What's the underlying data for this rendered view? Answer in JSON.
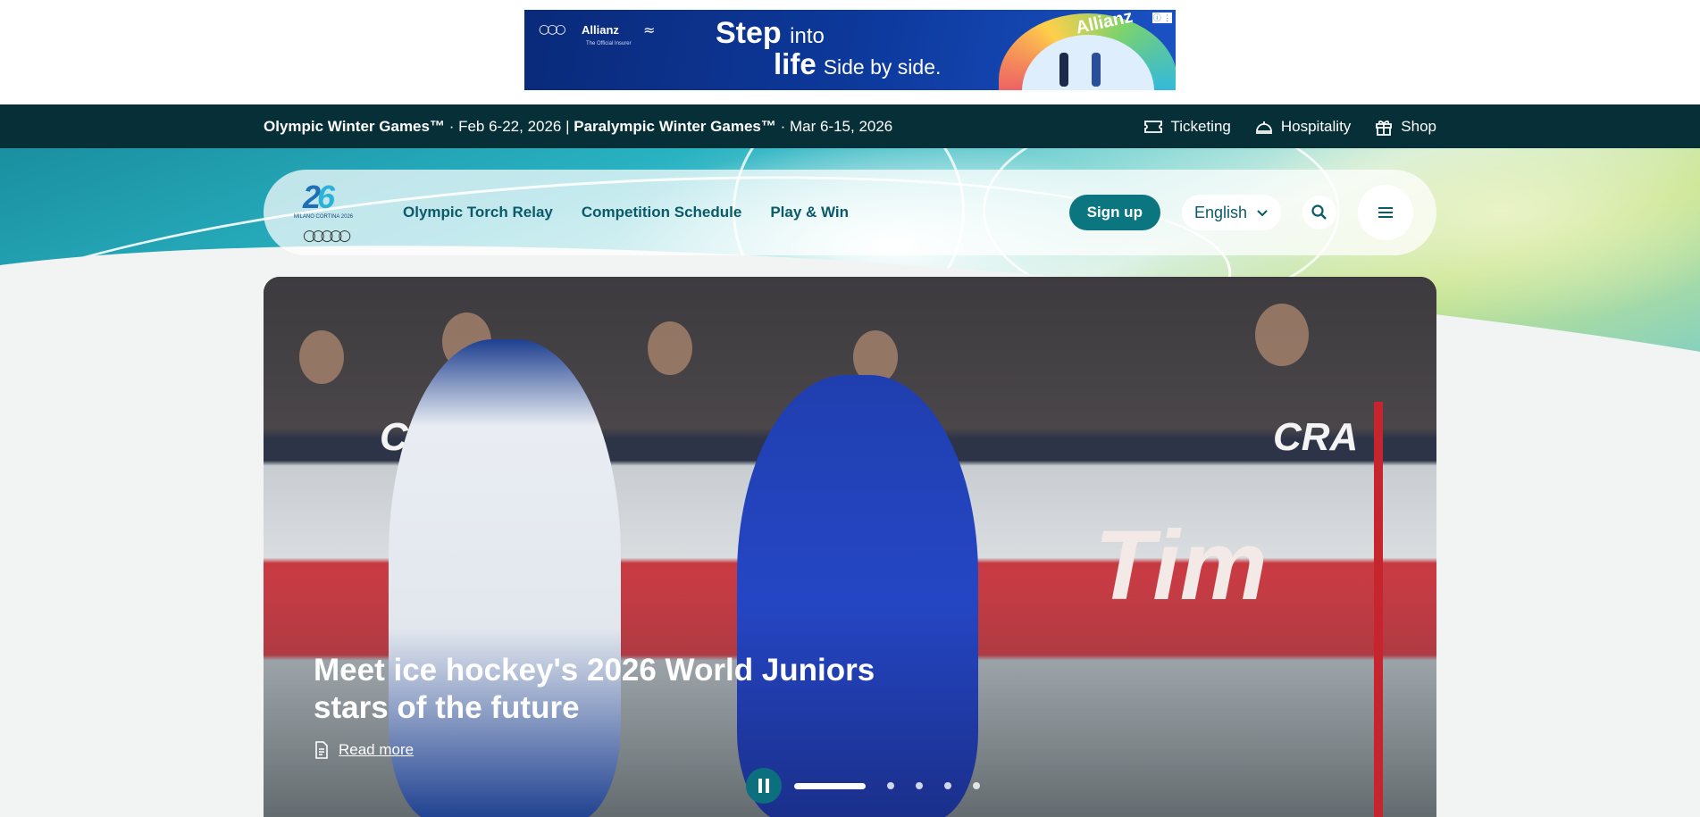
{
  "ad": {
    "brand": "Allianz",
    "brand_sub": "The Official Insurer",
    "headline_word1": "Step",
    "headline_word2": "into",
    "headline_word3": "life",
    "headline_word4": "Side by side.",
    "arc_word": "Allianz"
  },
  "infobar": {
    "olympic_label": "Olympic Winter Games™",
    "olympic_dates": " · Feb 6-22, 2026 | ",
    "paralympic_label": "Paralympic Winter Games™",
    "paralympic_dates": " · Mar 6-15, 2026",
    "links": [
      {
        "label": "Ticketing",
        "icon": "ticket-icon"
      },
      {
        "label": "Hospitality",
        "icon": "cloche-icon"
      },
      {
        "label": "Shop",
        "icon": "gift-icon"
      }
    ]
  },
  "nav": {
    "logo_text": "MILANO CORTINA 2026",
    "links": [
      "Olympic Torch Relay",
      "Competition Schedule",
      "Play & Win"
    ],
    "signup_label": "Sign up",
    "language": "English"
  },
  "hero": {
    "headline": "Meet ice hockey's 2026 World Juniors stars of the future",
    "read_more": "Read more",
    "slides": 5,
    "active_slide": 1
  },
  "colors": {
    "dark_teal": "#062f37",
    "accent_teal": "#0b7580",
    "link_teal": "#0b5a6a"
  }
}
